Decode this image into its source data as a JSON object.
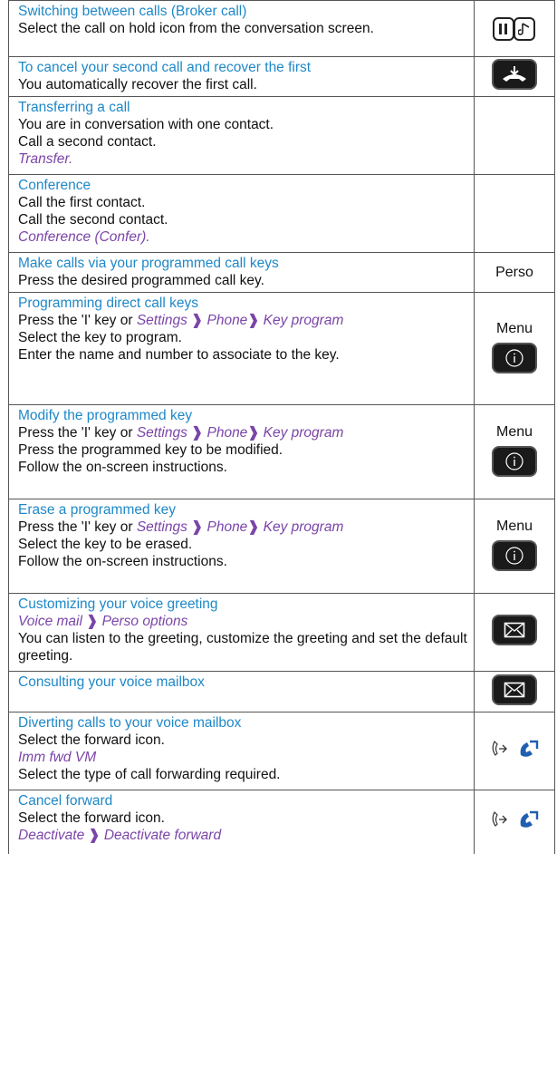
{
  "arrow": "❱",
  "rows": [
    {
      "title": "Switching between calls (Broker call)",
      "lines": [
        "Select the call on hold icon from the conversation screen."
      ]
    },
    {
      "title": "To cancel your second call and recover the first",
      "lines": [
        "You automatically recover the first call."
      ]
    },
    {
      "title": "Transferring a call",
      "lines": [
        "You are in conversation with one contact.",
        "Call a second contact."
      ],
      "italic": "Transfer."
    },
    {
      "title": "Conference",
      "lines": [
        "Call the first contact.",
        "Call the second contact."
      ],
      "italic": "Conference (Confer)."
    },
    {
      "title": "Make calls via your programmed call keys",
      "lines": [
        "Press the desired programmed call key."
      ],
      "icon_word": "Perso"
    },
    {
      "title": "Programming direct call keys",
      "press_prefix": "Press the 'I' key or",
      "path": [
        "Settings",
        "Phone",
        "Key program"
      ],
      "lines": [
        "Select the key to program.",
        "Enter the name and number to associate to the key."
      ],
      "icon_word": "Menu"
    },
    {
      "title": "Modify the programmed key",
      "press_prefix": "Press the 'I' key or",
      "path": [
        "Settings",
        "Phone",
        "Key program"
      ],
      "lines": [
        "Press the programmed key to be modified.",
        "Follow the on-screen instructions."
      ],
      "icon_word": "Menu"
    },
    {
      "title": "Erase a programmed key",
      "press_prefix": "Press the 'I' key or",
      "path": [
        "Settings",
        "Phone",
        "Key program"
      ],
      "lines": [
        "Select the key to be erased.",
        "Follow the on-screen instructions."
      ],
      "icon_word": "Menu"
    },
    {
      "title": "Customizing your voice greeting",
      "path": [
        "Voice mail",
        "Perso options"
      ],
      "lines": [
        "You can listen to the greeting, customize the greeting and set the default greeting."
      ]
    },
    {
      "title": "Consulting your voice mailbox"
    },
    {
      "title": "Diverting calls to your voice mailbox",
      "lines": [
        "Select the forward icon."
      ],
      "italic": "Imm fwd VM",
      "lines_after": [
        "Select the type of call forwarding required."
      ]
    },
    {
      "title": "Cancel forward",
      "lines": [
        "Select the forward icon."
      ],
      "path": [
        "Deactivate",
        "Deactivate forward"
      ]
    }
  ],
  "icons": {
    "hold": "call-on-hold-icon",
    "hangup": "hang-up-key-icon",
    "info": "info-key-icon",
    "mail": "voicemail-key-icon",
    "forward": "forward-icon",
    "voicemail_handset": "voicemail-handset-icon"
  }
}
